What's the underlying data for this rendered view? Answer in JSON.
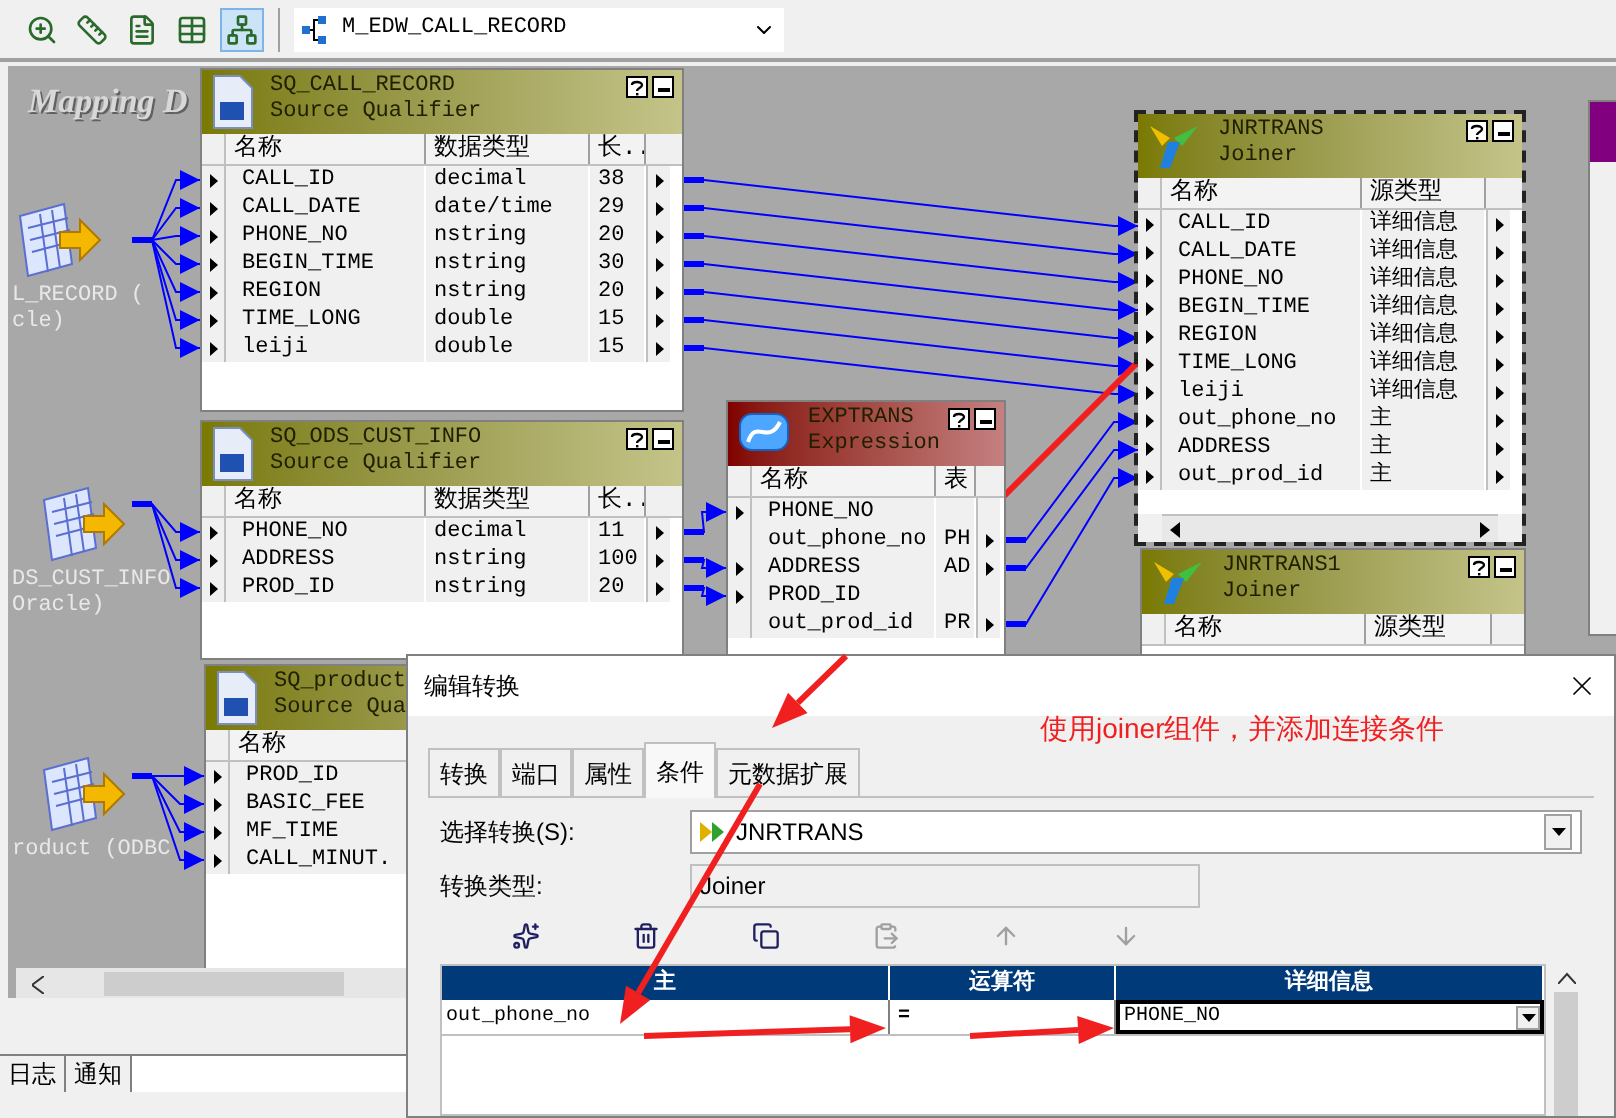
{
  "toolbar": {
    "buttons": [
      {
        "selected": false
      },
      {
        "selected": false
      },
      {
        "selected": false
      },
      {
        "selected": false
      },
      {
        "selected": true
      }
    ],
    "mapping_select": "M_EDW_CALL_RECORD"
  },
  "canvas": {
    "title": "Mapping D",
    "sources": [
      {
        "label_lines": [
          "L_RECORD (",
          "cle)"
        ]
      },
      {
        "label_lines": [
          "DS_CUST_INFO",
          "Oracle)"
        ]
      },
      {
        "label_lines": [
          "roduct (ODBC"
        ]
      }
    ],
    "transformations": [
      {
        "kind": "source_qualifier",
        "name": "SQ_CALL_RECORD",
        "type": "Source Qualifier",
        "selected": false,
        "columns": [
          "名称",
          "数据类型",
          "长.."
        ],
        "rows": [
          {
            "cells": [
              "CALL_ID",
              "decimal",
              "38"
            ],
            "input": true,
            "output": true
          },
          {
            "cells": [
              "CALL_DATE",
              "date/time",
              "29"
            ],
            "input": true,
            "output": true
          },
          {
            "cells": [
              "PHONE_NO",
              "nstring",
              "20"
            ],
            "input": true,
            "output": true
          },
          {
            "cells": [
              "BEGIN_TIME",
              "nstring",
              "30"
            ],
            "input": true,
            "output": true
          },
          {
            "cells": [
              "REGION",
              "nstring",
              "20"
            ],
            "input": true,
            "output": true
          },
          {
            "cells": [
              "TIME_LONG",
              "double",
              "15"
            ],
            "input": true,
            "output": true
          },
          {
            "cells": [
              "leiji",
              "double",
              "15"
            ],
            "input": true,
            "output": true
          }
        ]
      },
      {
        "kind": "source_qualifier",
        "name": "SQ_ODS_CUST_INFO",
        "type": "Source Qualifier",
        "selected": false,
        "columns": [
          "名称",
          "数据类型",
          "长.."
        ],
        "rows": [
          {
            "cells": [
              "PHONE_NO",
              "decimal",
              "11"
            ],
            "input": true,
            "output": true
          },
          {
            "cells": [
              "ADDRESS",
              "nstring",
              "100"
            ],
            "input": true,
            "output": true
          },
          {
            "cells": [
              "PROD_ID",
              "nstring",
              "20"
            ],
            "input": true,
            "output": true
          }
        ]
      },
      {
        "kind": "source_qualifier",
        "name": "SQ_product",
        "type": "Source Qua",
        "selected": false,
        "columns": [
          "名称"
        ],
        "rows": [
          {
            "cells": [
              "PROD_ID"
            ],
            "input": true
          },
          {
            "cells": [
              "BASIC_FEE"
            ],
            "input": true
          },
          {
            "cells": [
              "MF_TIME"
            ],
            "input": true
          },
          {
            "cells": [
              "CALL_MINUT."
            ],
            "input": true
          }
        ]
      },
      {
        "kind": "expression",
        "name": "EXPTRANS",
        "type": "Expression",
        "selected": false,
        "columns": [
          "名称",
          "表"
        ],
        "rows": [
          {
            "cells": [
              "PHONE_NO",
              ""
            ],
            "input": true,
            "output": false
          },
          {
            "cells": [
              "out_phone_no",
              "PH"
            ],
            "input": false,
            "output": true
          },
          {
            "cells": [
              "ADDRESS",
              "AD"
            ],
            "input": true,
            "output": true
          },
          {
            "cells": [
              "PROD_ID",
              ""
            ],
            "input": true,
            "output": false
          },
          {
            "cells": [
              "out_prod_id",
              "PR"
            ],
            "input": false,
            "output": true
          }
        ]
      },
      {
        "kind": "joiner",
        "name": "JNRTRANS",
        "type": "Joiner",
        "selected": true,
        "columns": [
          "名称",
          "源类型"
        ],
        "rows": [
          {
            "cells": [
              "CALL_ID",
              "详细信息"
            ],
            "input": true,
            "output": true
          },
          {
            "cells": [
              "CALL_DATE",
              "详细信息"
            ],
            "input": true,
            "output": true
          },
          {
            "cells": [
              "PHONE_NO",
              "详细信息"
            ],
            "input": true,
            "output": true
          },
          {
            "cells": [
              "BEGIN_TIME",
              "详细信息"
            ],
            "input": true,
            "output": true
          },
          {
            "cells": [
              "REGION",
              "详细信息"
            ],
            "input": true,
            "output": true
          },
          {
            "cells": [
              "TIME_LONG",
              "详细信息"
            ],
            "input": true,
            "output": true
          },
          {
            "cells": [
              "leiji",
              "详细信息"
            ],
            "input": true,
            "output": true
          },
          {
            "cells": [
              "out_phone_no",
              "主"
            ],
            "input": true,
            "output": true
          },
          {
            "cells": [
              "ADDRESS",
              "主"
            ],
            "input": true,
            "output": true
          },
          {
            "cells": [
              "out_prod_id",
              "主"
            ],
            "input": true,
            "output": true
          }
        ]
      },
      {
        "kind": "joiner",
        "name": "JNRTRANS1",
        "type": "Joiner",
        "selected": false,
        "columns": [
          "名称",
          "源类型"
        ]
      }
    ]
  },
  "bottom_tabs": [
    {
      "label": "日志",
      "selected": false
    },
    {
      "label": "通知",
      "selected": false
    }
  ],
  "dialog": {
    "title": "编辑转换",
    "tabs": [
      {
        "label": "转换",
        "selected": false
      },
      {
        "label": "端口",
        "selected": false
      },
      {
        "label": "属性",
        "selected": false
      },
      {
        "label": "条件",
        "selected": true
      },
      {
        "label": "元数据扩展",
        "selected": false
      }
    ],
    "select_label": "选择转换(S):",
    "select_value": "JNRTRANS",
    "type_label": "转换类型:",
    "type_value": "Joiner",
    "tools": [
      {
        "kind": "new",
        "disabled": false
      },
      {
        "kind": "delete",
        "disabled": false
      },
      {
        "kind": "copy",
        "disabled": false
      },
      {
        "kind": "paste",
        "disabled": true
      },
      {
        "kind": "up",
        "disabled": true
      },
      {
        "kind": "down",
        "disabled": true
      }
    ],
    "condition_columns": [
      "主",
      "运算符",
      "详细信息"
    ],
    "conditions": [
      {
        "master": "out_phone_no",
        "operator": "=",
        "detail": "PHONE_NO"
      }
    ]
  },
  "annotation": "使用joiner组件，并添加连接条件"
}
